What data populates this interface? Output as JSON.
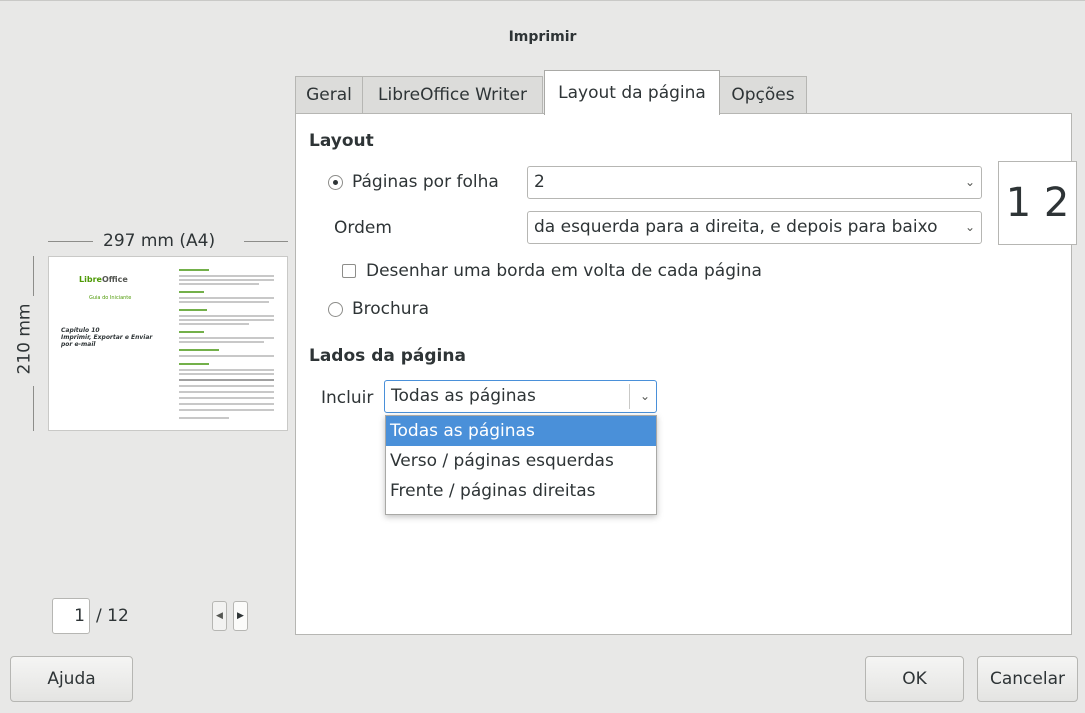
{
  "window": {
    "title": "Imprimir"
  },
  "tabs": [
    {
      "label": "Geral",
      "active": false
    },
    {
      "label": "LibreOffice Writer",
      "active": false
    },
    {
      "label": "Layout da página",
      "active": true
    },
    {
      "label": "Opções",
      "active": false
    }
  ],
  "layout": {
    "section_title": "Layout",
    "pages_per_sheet": {
      "label": "Páginas por folha",
      "value": "2",
      "checked": true
    },
    "order": {
      "label": "Ordem",
      "value": "da esquerda para a direita, e depois para baixo"
    },
    "order_preview": "1 2",
    "draw_border": {
      "label": "Desenhar uma borda em volta de cada página",
      "checked": false
    },
    "brochure": {
      "label": "Brochura",
      "checked": false
    }
  },
  "page_sides": {
    "section_title": "Lados da página",
    "include_label": "Incluir",
    "include_value": "Todas as páginas",
    "options": [
      "Todas as páginas",
      "Verso / páginas esquerdas",
      "Frente / páginas direitas"
    ],
    "selected_index": 0
  },
  "preview": {
    "width_label": "297 mm (A4)",
    "height_label": "210 mm",
    "logo_text": "Libre",
    "logo_text2": "Office",
    "guide_text": "Guia do Iniciante",
    "chapter_title": "Capítulo 10\nImprimir, Exportar e Enviar por e-mail"
  },
  "page_nav": {
    "current": "1",
    "total": "/ 12"
  },
  "buttons": {
    "help": "Ajuda",
    "ok": "OK",
    "cancel": "Cancelar"
  },
  "colors": {
    "selection": "#4a90d9",
    "background": "#e8e8e7",
    "accent_green": "#4e9a06"
  }
}
